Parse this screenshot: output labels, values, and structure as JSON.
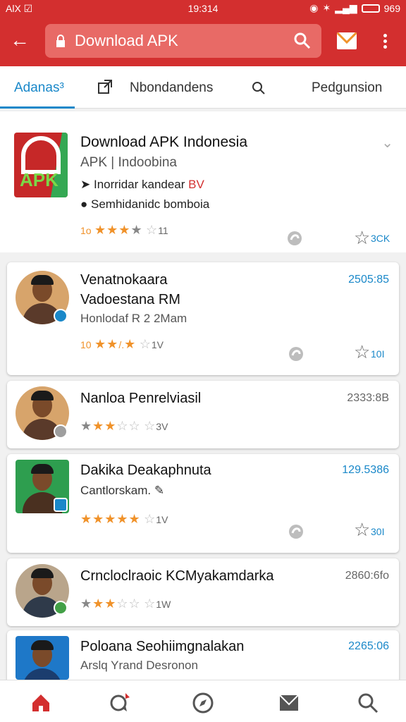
{
  "status_bar": {
    "left": "AlX ☑",
    "time": "19:314",
    "battery": "969"
  },
  "app_bar": {
    "search_text": "Download APK",
    "colors": {
      "primary": "#d32f2f",
      "accent": "#1a88c9"
    }
  },
  "tabs": [
    "Adanas³",
    "Nbondandens",
    "Pedgunsion"
  ],
  "hero": {
    "title": "Download APK Indonesia",
    "subtitle": "APK | Indoobina",
    "line1": "Inorridar kandear",
    "line1_tag": "BV",
    "line2": "Semhidanidc bomboia",
    "rating_lead": "1o",
    "rating_count": "11",
    "fav_count": "3CK",
    "stars": 4
  },
  "cards": [
    {
      "title": "Venatnokaara",
      "title2": "Vadoestana",
      "title2_extra": "RM",
      "sub": "Honlodaf R 2 2Mam",
      "num": "2505:85",
      "lead": "10",
      "count": "1V",
      "fav": "10I",
      "stars": 4
    },
    {
      "title": "Nanloa Penrelviasil",
      "num": "2333:8B",
      "count": "3V",
      "stars": 3
    },
    {
      "title": "Dakika Deakaphnuta",
      "sub": "Cantlorskam.",
      "num": "129.5386",
      "count": "1V",
      "fav": "30I",
      "stars": 5
    },
    {
      "title": "Crncloclraoic KCMyakamdarka",
      "num": "2860:6fo",
      "count": "1W",
      "stars": 3
    },
    {
      "title": "Poloana Seohiimgnalakan",
      "sub": "Arslq Yrand Desronon",
      "num": "2265:06"
    }
  ]
}
